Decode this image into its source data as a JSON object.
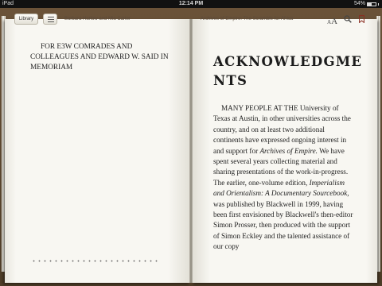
{
  "status_bar": {
    "device": "iPad",
    "time": "12:14 PM",
    "battery": "54%"
  },
  "toolbar": {
    "library_label": "Library",
    "author": "Barbara Harlow and Mia Carter",
    "book_title": "Archives of Empire: The Scramble for Africa",
    "font_label_small": "A",
    "font_label_large": "A"
  },
  "left_page": {
    "dedication": "FOR E3W COMRADES AND COLLEAGUES AND EDWARD W. SAID IN MEMORIAM"
  },
  "right_page": {
    "chapter_title": "ACKNOWLEDGMENTS",
    "body_1": "MANY PEOPLE AT THE University of Texas at Austin, in other universities across the country, and on at least two additional continents have expressed ongoing interest in and support for ",
    "body_italic_1": "Archives of Empire.",
    "body_2": " We have spent several years collecting material and sharing presentations of the work-in-progress. The earlier, one-volume edition, ",
    "body_italic_2": "Imperialism and Orientalism: A Documentary Sourcebook",
    "body_3": ", was published by Blackwell in 1999, having been first envisioned by Blackwell's then-editor Simon Prosser, then produced with the support of Simon Eckley and the talented assistance of our copy"
  },
  "icons": [
    "toc-icon",
    "font-size-icon",
    "search-icon",
    "bookmark-icon"
  ]
}
